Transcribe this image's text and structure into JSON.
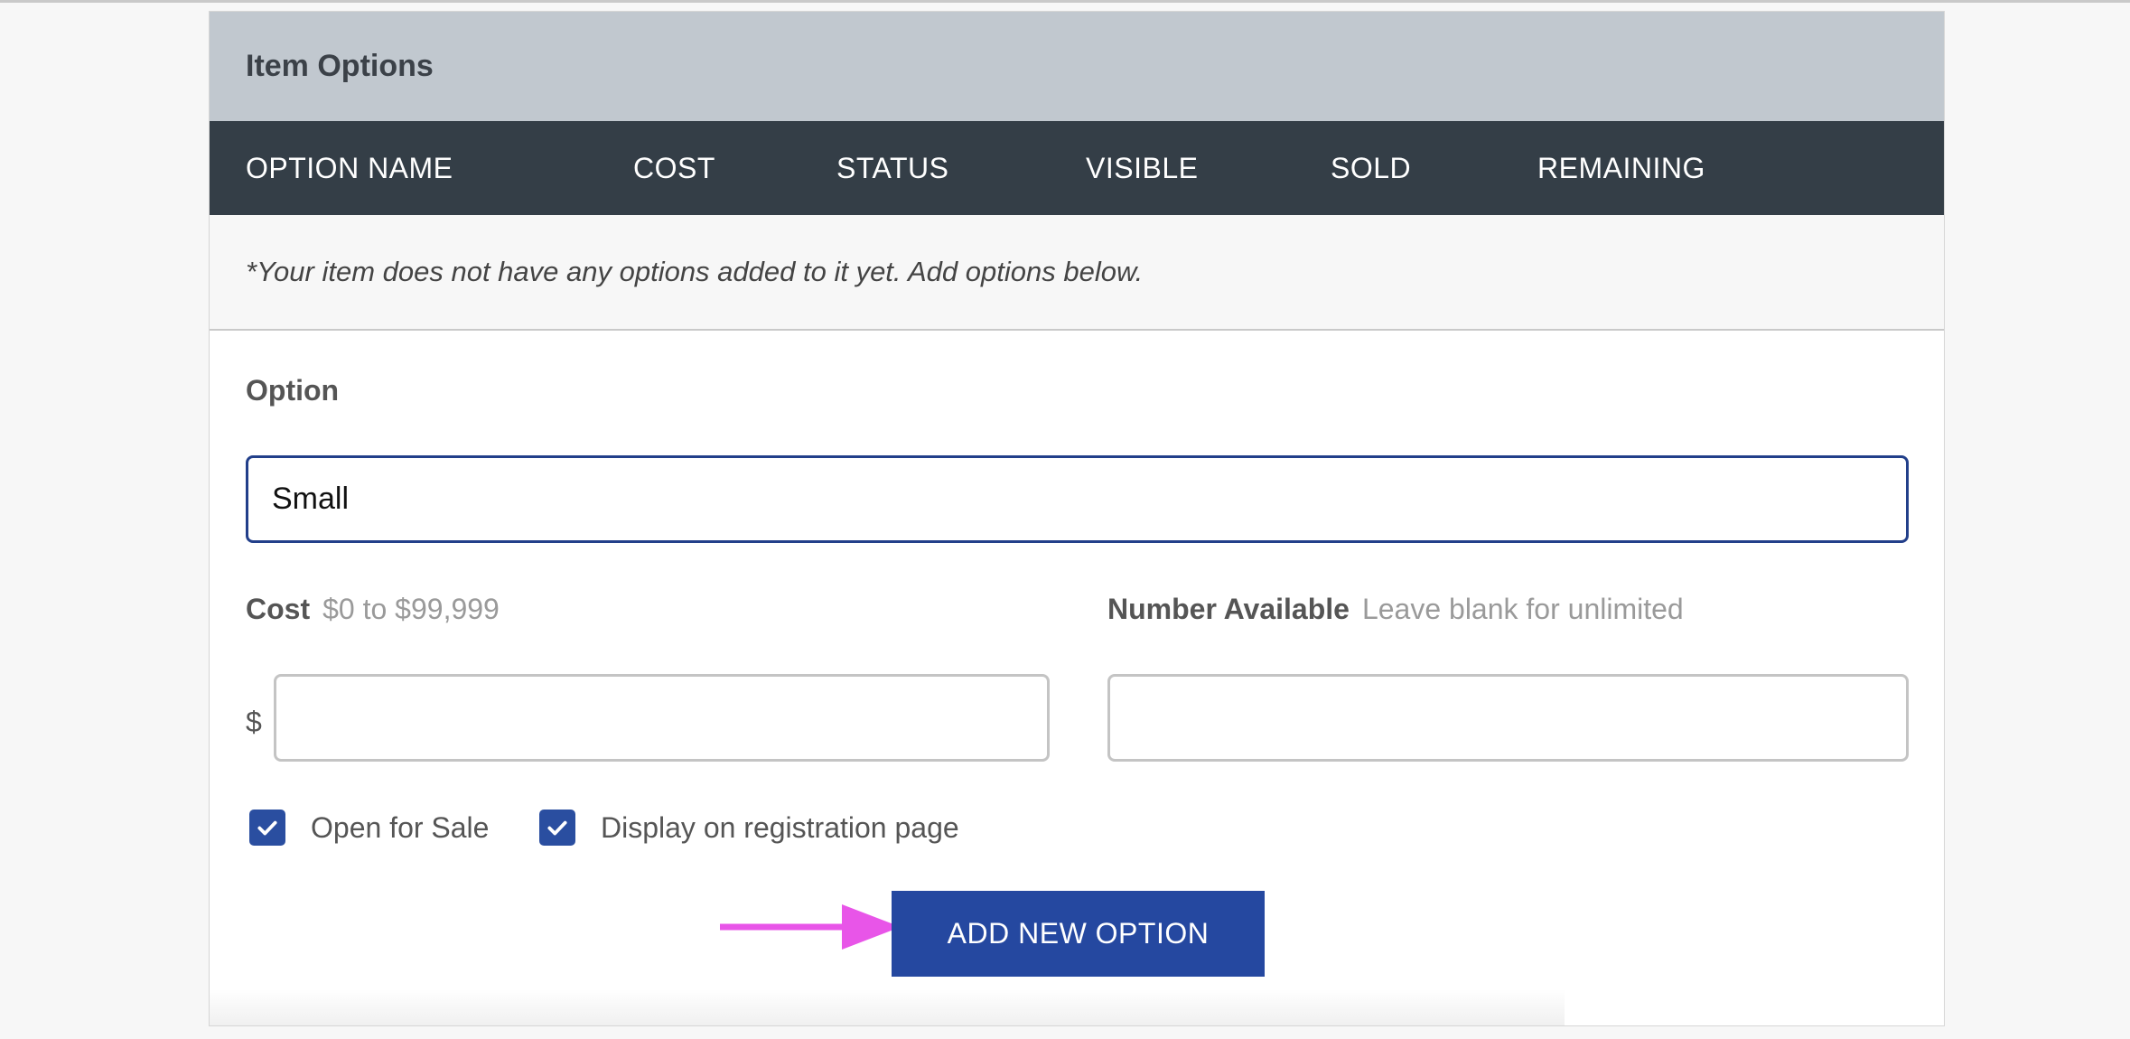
{
  "panel": {
    "title": "Item Options"
  },
  "table": {
    "columns": [
      "OPTION NAME",
      "COST",
      "STATUS",
      "VISIBLE",
      "SOLD",
      "REMAINING"
    ],
    "empty_message": "*Your item does not have any options added to it yet. Add options below."
  },
  "form": {
    "option_label": "Option",
    "option_value": "Small",
    "cost_label": "Cost",
    "cost_hint": "$0 to $99,999",
    "currency_symbol": "$",
    "cost_value": "",
    "number_label": "Number Available",
    "number_hint": "Leave blank for unlimited",
    "number_value": "",
    "checkboxes": [
      {
        "label": "Open for Sale",
        "checked": true
      },
      {
        "label": "Display on registration page",
        "checked": true
      }
    ],
    "add_button_label": "ADD NEW OPTION"
  },
  "colors": {
    "header_bg": "#c1c8cf",
    "table_head_bg": "#343e47",
    "accent": "#2548a0",
    "annotation_arrow": "#e855e8"
  }
}
